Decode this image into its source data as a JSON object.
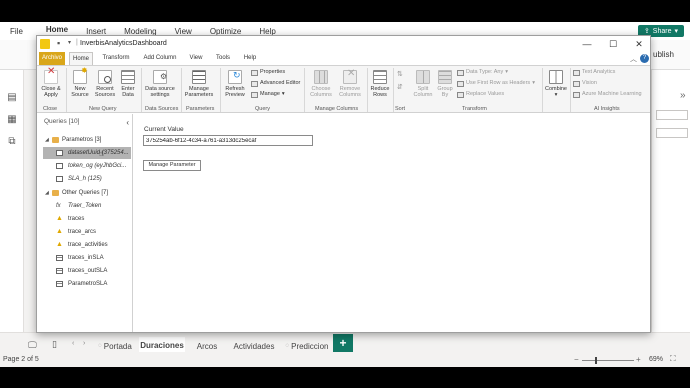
{
  "pbi": {
    "menu": [
      "File",
      "Home",
      "Insert",
      "Modeling",
      "View",
      "Optimize",
      "Help"
    ],
    "share_label": "Share",
    "publish_label": "ublish",
    "status_page": "Page 2 of 5",
    "zoom": "69%",
    "pages": [
      "Portada",
      "Duraciones",
      "Arcos",
      "Actividades",
      "Prediccion"
    ],
    "add_page": "+"
  },
  "pqe": {
    "title": "InverbisAnalyticsDashboard",
    "ribbon_tabs": [
      "Archivo",
      "Home",
      "Transform",
      "Add Column",
      "View",
      "Tools",
      "Help"
    ],
    "buttons": {
      "close_apply": "Close & Apply",
      "new_source": "New Source",
      "recent_sources": "Recent Sources",
      "enter_data": "Enter Data",
      "data_source_settings": "Data source settings",
      "manage_parameters": "Manage Parameters",
      "refresh_preview": "Refresh Preview",
      "properties": "Properties",
      "advanced_editor": "Advanced Editor",
      "manage": "Manage",
      "choose_columns": "Choose Columns",
      "remove_columns": "Remove Columns",
      "reduce_rows": "Reduce Rows",
      "split_column": "Split Column",
      "group_by": "Group By",
      "data_type": "Data Type: Any",
      "first_row_headers": "Use First Row as Headers",
      "replace_values": "Replace Values",
      "combine": "Combine",
      "text_analytics": "Text Analytics",
      "vision": "Vision",
      "azure_ml": "Azure Machine Learning"
    },
    "groups": {
      "close": "Close",
      "new_query": "New Query",
      "data_sources": "Data Sources",
      "parameters": "Parameters",
      "query": "Query",
      "manage_columns": "Manage Columns",
      "sort": "Sort",
      "transform": "Transform",
      "ai_insights": "AI Insights"
    },
    "queries_header": "Queries [10]",
    "queries": {
      "group1": "Parametros [3]",
      "q1": "datasetUuid (375254...",
      "q2": "token_og (eyJhbGci...",
      "q3": "SLA_h (125)",
      "group2": "Other Queries [7]",
      "q4": "Traer_Token",
      "q5": "traces",
      "q6": "trace_arcs",
      "q7": "trace_activities",
      "q8": "traces_inSLA",
      "q9": "traces_outSLA",
      "q10": "ParametroSLA"
    },
    "current_value_label": "Current Value",
    "current_value": "375254ab-6f12-4c34-a761-a313dc25ecaf",
    "manage_parameter_btn": "Manage Parameter"
  },
  "colors": {
    "brand_green": "#117865",
    "archivo_tab": "#d9a61a",
    "selected_row": "#b3b3b3",
    "warning": "#e0a800"
  }
}
